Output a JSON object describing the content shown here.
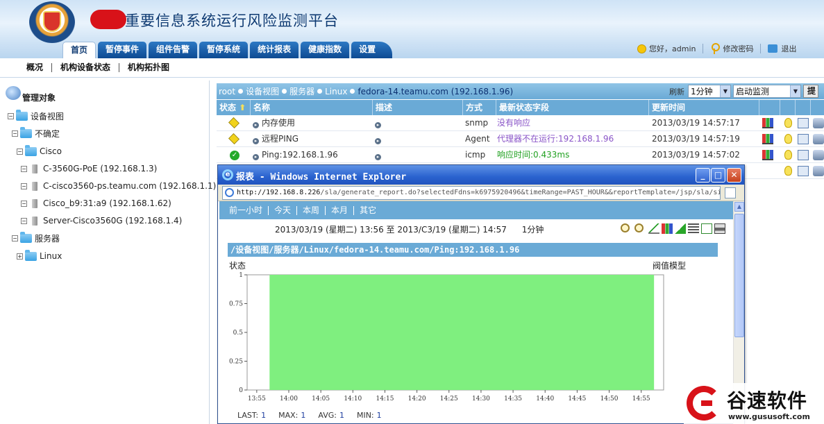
{
  "app": {
    "title": "重要信息系统运行风险监测平台",
    "top_tabs": [
      "首页",
      "暂停事件",
      "组件告警",
      "暂停系统",
      "统计报表",
      "健康指数",
      "设置"
    ],
    "active_tab": "首页",
    "greeting": "您好，admin",
    "change_password": "修改密码",
    "logout": "退出"
  },
  "sub_nav": [
    "概况",
    "机构设备状态",
    "机构拓扑图"
  ],
  "tree": {
    "root": "管理对象",
    "nodes": [
      {
        "label": "设备视图",
        "toggle": "⊟",
        "icon": "folder-icon"
      },
      {
        "label": "不确定",
        "toggle": "⊟",
        "icon": "folder-icon"
      },
      {
        "label": "Cisco",
        "toggle": "⊟",
        "icon": "folder-icon"
      },
      {
        "label": "C-3560G-PoE (192.168.1.3)",
        "toggle": "⊟",
        "icon": "device-icon"
      },
      {
        "label": "C-cisco3560-ps.teamu.com (192.168.1.1)",
        "toggle": "⊟",
        "icon": "device-icon"
      },
      {
        "label": "Cisco_b9:31:a9 (192.168.1.62)",
        "toggle": "⊟",
        "icon": "device-icon"
      },
      {
        "label": "Server-Cisco3560G (192.168.1.4)",
        "toggle": "⊟",
        "icon": "device-icon"
      },
      {
        "label": "服务器",
        "toggle": "⊟",
        "icon": "folder-icon"
      },
      {
        "label": "Linux",
        "toggle": "⊞",
        "icon": "folder-icon"
      }
    ]
  },
  "breadcrumb": [
    "root",
    "设备视图",
    "服务器",
    "Linux",
    "fedora-14.teamu.com (192.168.1.96)"
  ],
  "refresh": {
    "label": "刷新",
    "interval": "1分钟",
    "monitor": "启动监测",
    "button_partial": "提"
  },
  "monitor_table": {
    "headers": {
      "status": "状态",
      "name": "名称",
      "desc": "描述",
      "method": "方式",
      "latest": "最新状态字段",
      "updated": "更新时间"
    },
    "rows": [
      {
        "status": "warning",
        "name": "内存使用",
        "method": "snmp",
        "latest": "没有响应",
        "latest_color": "#8a55c8",
        "updated": "2013/03/19 14:57:17"
      },
      {
        "status": "warning",
        "name": "远程PING",
        "method": "Agent",
        "latest": "代理器不在运行:192.168.1.96",
        "latest_color": "#8a55c8",
        "updated": "2013/03/19 14:57:19"
      },
      {
        "status": "ok",
        "name": "Ping:192.168.1.96",
        "method": "icmp",
        "latest": "响应时间:0.433ms",
        "latest_color": "#21a121",
        "updated": "2013/03/19 14:57:02"
      }
    ]
  },
  "popup": {
    "window_title": "报表 - Windows Internet Explorer",
    "address_host": "http://192.168.8.226",
    "address_path": "/sla/generate_report.do?selectedFdns=k6975920496&timeRange=PAST_HOUR&&reportTemplate=/jsp/sla/si",
    "ranges": [
      "前一小时",
      "今天",
      "本周",
      "本月",
      "其它"
    ],
    "range_info": "2013/03/19 (星期二) 13:56 至  2013/C3/19 (星期二) 14:57",
    "interval": "1分钟",
    "report_title": "/设备视图/服务器/Linux/fedora-14.teamu.com/Ping:192.168.1.96",
    "state_label": "状态",
    "threshold_label": "阀值模型",
    "stats": {
      "last_label": "LAST:",
      "last": "1",
      "max_label": "MAX:",
      "max": "1",
      "avg_label": "AVG:",
      "avg": "1",
      "min_label": "MIN:",
      "min": "1"
    }
  },
  "chart_data": {
    "type": "area",
    "x": [
      "13:55",
      "14:00",
      "14:05",
      "14:10",
      "14:15",
      "14:20",
      "14:25",
      "14:30",
      "14:35",
      "14:40",
      "14:45",
      "14:50",
      "14:55"
    ],
    "y_ticks": [
      "0",
      "0.25",
      "0.5",
      "0.75",
      "1"
    ],
    "series": [
      {
        "x_start": "13:57",
        "x_end": "14:57",
        "value": 1
      }
    ],
    "ylim": [
      0,
      1
    ],
    "fill_color": "#7fef7f",
    "grid": false
  },
  "watermark": {
    "cn": "谷速软件",
    "url": "www.gususoft.com"
  }
}
